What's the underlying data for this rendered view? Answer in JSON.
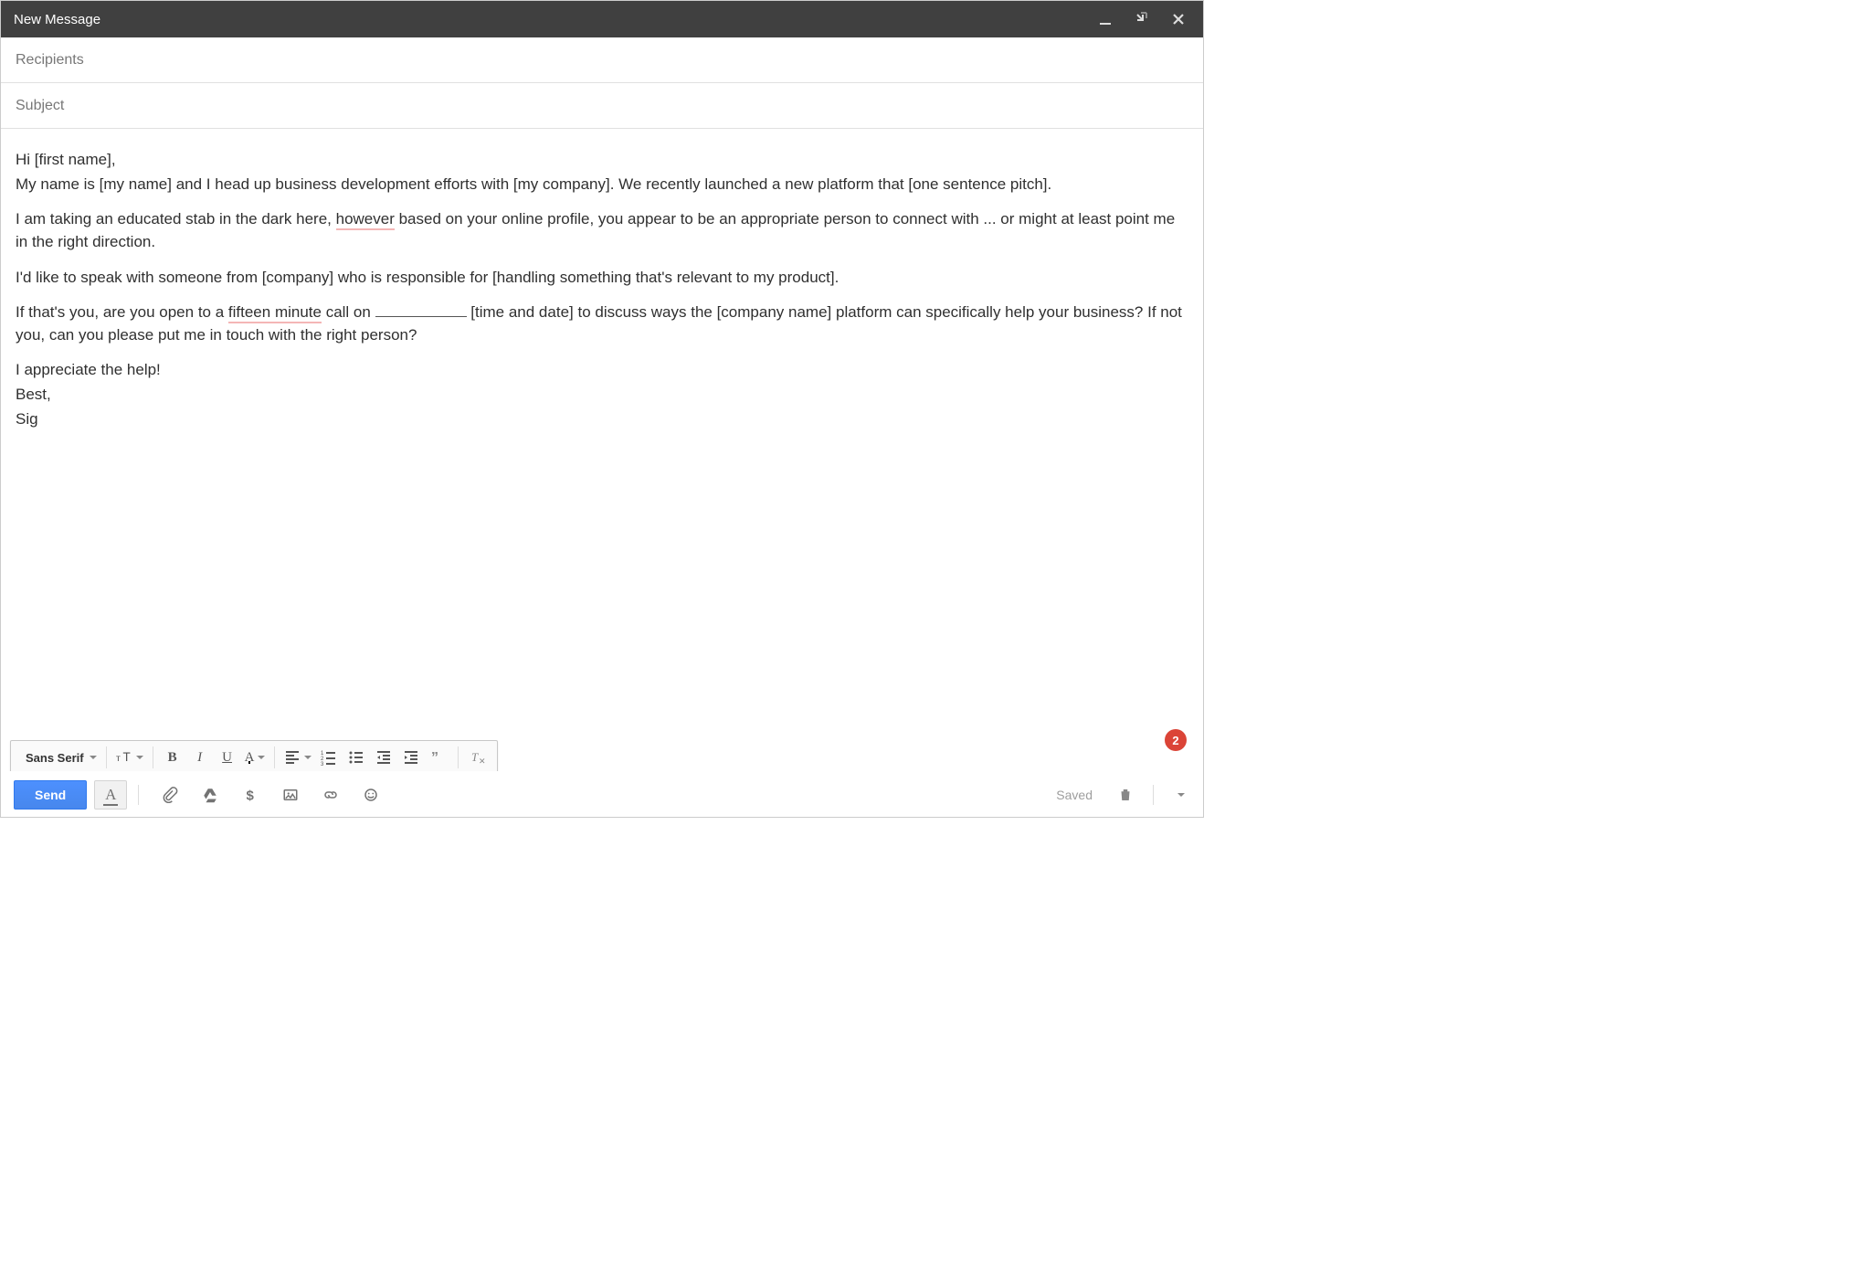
{
  "window": {
    "title": "New Message"
  },
  "fields": {
    "recipients_placeholder": "Recipients",
    "recipients_value": "",
    "subject_placeholder": "Subject",
    "subject_value": ""
  },
  "body": {
    "p1": "Hi [first name],",
    "p2a": "My name is [my name] and I head up business development efforts with [my company]. We recently launched a new platform that [one sentence pitch].",
    "p3a": "I am taking an educated stab in the dark here, ",
    "p3_flag": "however",
    "p3b": " based on your online profile, you appear to be an appropriate person to connect with ... or might at least point me in the right direction.",
    "p4": "I'd like to speak with someone from [company] who is responsible for [handling something that's relevant to my product].",
    "p5a": "If that's you, are you open to a ",
    "p5_flag": "fifteen minute",
    "p5b": " call on ",
    "p5c": " [time and date] to discuss ways the [company name] platform can specifically help your business? If not you, can you please put me in touch with the right person?",
    "p6": "I appreciate the help!",
    "p7": "Best,",
    "p8": "Sig"
  },
  "format_toolbar": {
    "font_label": "Sans Serif"
  },
  "actionbar": {
    "send_label": "Send",
    "saved_label": "Saved"
  },
  "notification": {
    "count": "2"
  }
}
